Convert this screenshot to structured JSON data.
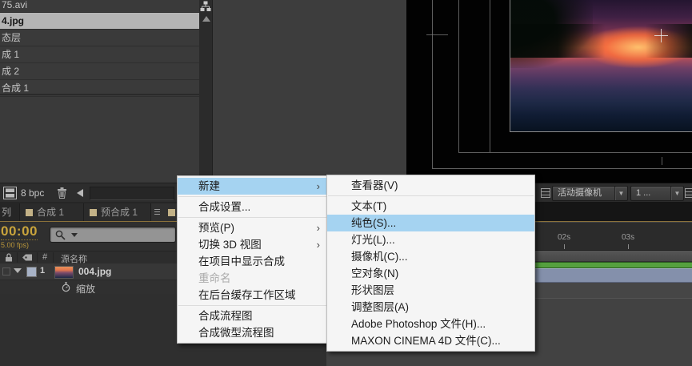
{
  "project_panel": {
    "items": [
      {
        "label": "75.avi",
        "selected": false
      },
      {
        "label": "4.jpg",
        "selected": true
      },
      {
        "label": "态层",
        "selected": false
      },
      {
        "label": "成 1",
        "selected": false
      },
      {
        "label": "成 2",
        "selected": false
      },
      {
        "label": "合成 1",
        "selected": false
      }
    ]
  },
  "bpc_bar": {
    "bpc_label": "8 bpc"
  },
  "tabs": {
    "queue_fragment": "列",
    "comp1": "合成 1",
    "precomp1": "预合成 1"
  },
  "timecode": {
    "value": "00:00",
    "fps": "5.00 fps)"
  },
  "timeline": {
    "columns": {
      "hash": "#",
      "source_name": "源名称"
    },
    "layer": {
      "index": "1",
      "name": "004.jpg",
      "property": "缩放"
    },
    "ruler": [
      "02s",
      "03s"
    ]
  },
  "viewer": {
    "camera_dropdown": "活动摄像机",
    "view_dropdown": "1 ..."
  },
  "context_menu": {
    "items": [
      {
        "type": "item",
        "label": "新建",
        "submenu": true,
        "highlight": true
      },
      {
        "type": "separator"
      },
      {
        "type": "item",
        "label": "合成设置..."
      },
      {
        "type": "separator"
      },
      {
        "type": "item",
        "label": "预览(P)",
        "submenu": true
      },
      {
        "type": "item",
        "label": "切换 3D 视图",
        "submenu": true
      },
      {
        "type": "item",
        "label": "在项目中显示合成"
      },
      {
        "type": "item",
        "label": "重命名",
        "disabled": true
      },
      {
        "type": "item",
        "label": "在后台缓存工作区域"
      },
      {
        "type": "separator"
      },
      {
        "type": "item",
        "label": "合成流程图"
      },
      {
        "type": "item",
        "label": "合成微型流程图"
      }
    ]
  },
  "submenu": {
    "items": [
      {
        "type": "item",
        "label": "查看器(V)"
      },
      {
        "type": "separator"
      },
      {
        "type": "item",
        "label": "文本(T)"
      },
      {
        "type": "item",
        "label": "纯色(S)...",
        "highlight": true
      },
      {
        "type": "item",
        "label": "灯光(L)..."
      },
      {
        "type": "item",
        "label": "摄像机(C)..."
      },
      {
        "type": "item",
        "label": "空对象(N)"
      },
      {
        "type": "item",
        "label": "形状图层"
      },
      {
        "type": "item",
        "label": "调整图层(A)"
      },
      {
        "type": "item",
        "label": "Adobe Photoshop 文件(H)..."
      },
      {
        "type": "item",
        "label": "MAXON CINEMA 4D 文件(C)..."
      }
    ]
  },
  "glyphs": {
    "submenu_arrow": "›",
    "dropdown_arrow": "▼"
  },
  "icons": [
    "flowchart-icon",
    "scroll-up-icon",
    "film-icon",
    "trash-icon",
    "back-arrow-icon",
    "search-icon",
    "lock-icon",
    "tag-icon",
    "stopwatch-icon",
    "grid-icon",
    "dropdown-arrow-icon",
    "submenu-arrow-icon",
    "color-swatch",
    "composition-square-icon"
  ],
  "colors": {
    "menu_highlight": "#a5d3f1",
    "timecode_gold": "#c9a43c",
    "panel_accent_gold": "#8a713a",
    "render_green": "#55a03e",
    "layer_bar": "#8490ab",
    "tab_square_tan": "#c3b287"
  }
}
